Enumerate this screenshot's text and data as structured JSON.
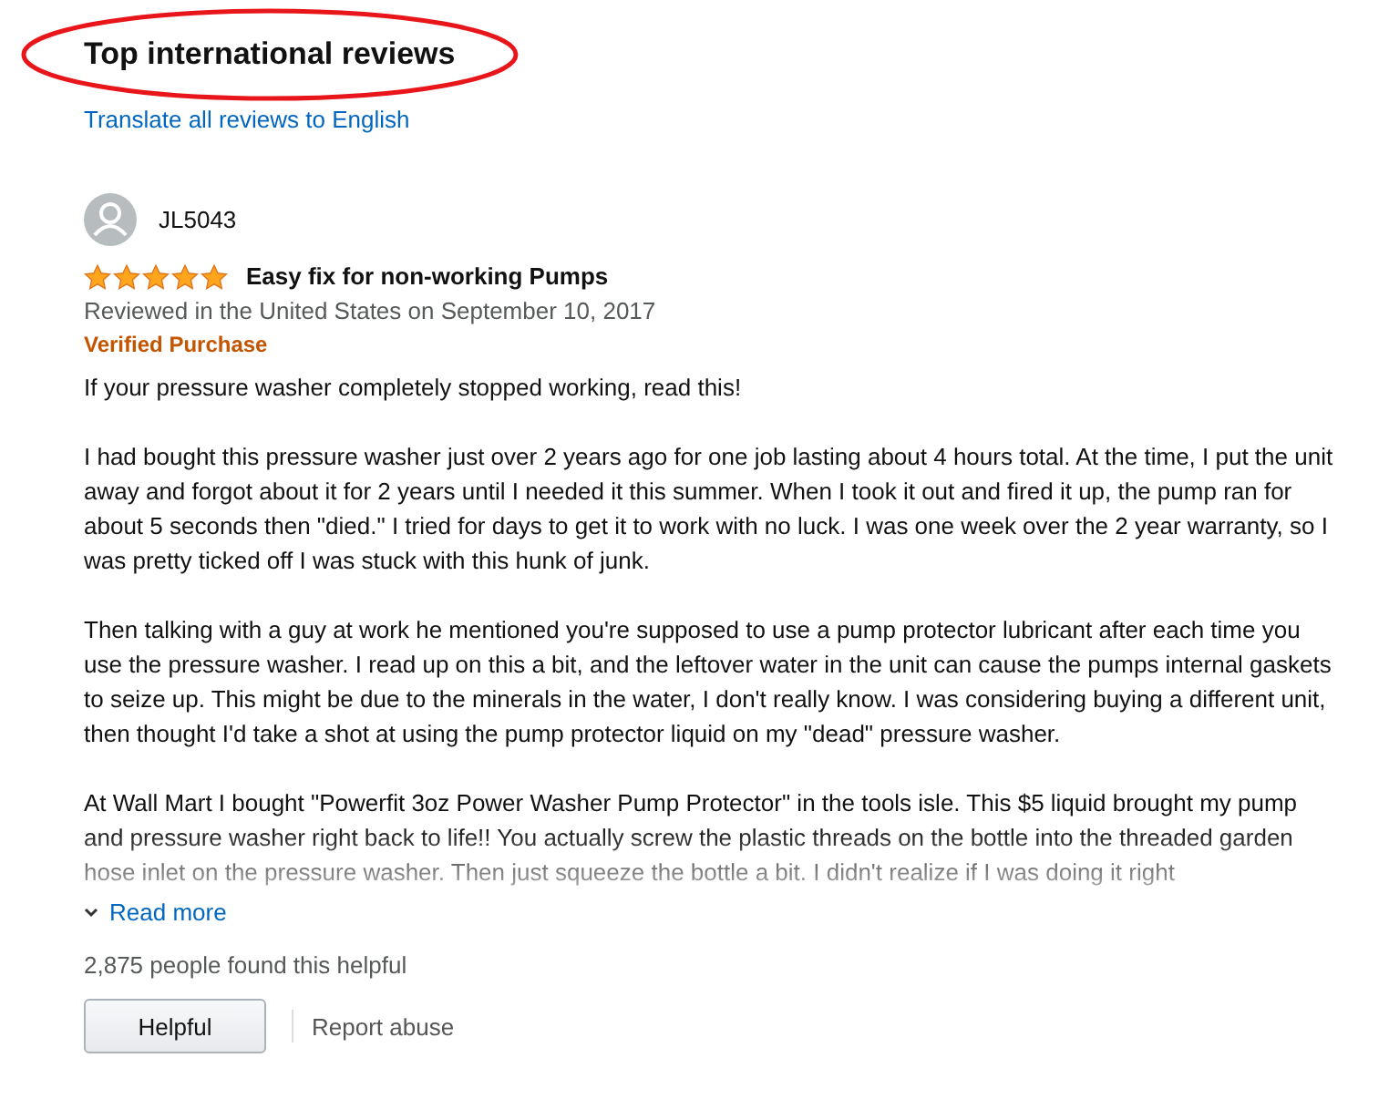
{
  "heading": "Top international reviews",
  "translate_link": "Translate all reviews to English",
  "review": {
    "author": "JL5043",
    "stars": 5,
    "title": "Easy fix for non-working Pumps",
    "meta": "Reviewed in the United States on September 10, 2017",
    "badge": "Verified Purchase",
    "paragraphs": [
      "If your pressure washer completely stopped working, read this!",
      "I had bought this pressure washer just over 2 years ago for one job lasting about 4 hours total. At the time, I put the unit away and forgot about it for 2 years until I needed it this summer. When I took it out and fired it up, the pump ran for about 5 seconds then \"died.\" I tried for days to get it to work with no luck. I was one week over the 2 year warranty, so I was pretty ticked off I was stuck with this hunk of junk.",
      "Then talking with a guy at work he mentioned you're supposed to use a pump protector lubricant after each time you use the pressure washer. I read up on this a bit, and the leftover water in the unit can cause the pumps internal gaskets to seize up. This might be due to the minerals in the water, I don't really know. I was considering buying a different unit, then thought I'd take a shot at using the pump protector liquid on my \"dead\" pressure washer.",
      "At Wall Mart I bought \"Powerfit 3oz Power Washer Pump Protector\" in the tools isle. This $5 liquid brought my pump and pressure washer right back to life!! You actually screw the plastic threads on the bottle into the threaded garden hose inlet on the pressure washer. Then just squeeze the bottle a bit. I didn't realize if I was doing it right"
    ],
    "read_more": "Read more",
    "helpful_count": "2,875 people found this helpful",
    "helpful_button": "Helpful",
    "report_link": "Report abuse"
  }
}
